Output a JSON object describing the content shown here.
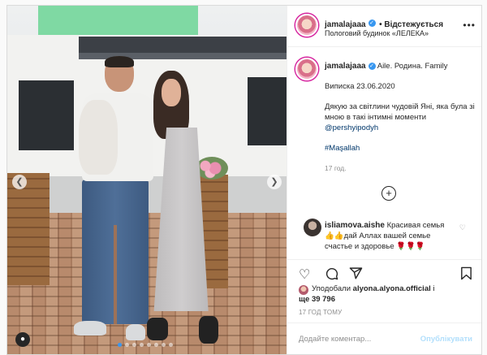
{
  "header": {
    "username": "jamalajaaa",
    "follow_status": "• Відстежується",
    "location": "Пологовий будинок «ЛЕЛЕКА»",
    "more_icon": "more-horizontal-icon"
  },
  "caption": {
    "username": "jamalajaaa",
    "line1": "Aile. Родина. Family",
    "line2": "Виписка 23.06.2020",
    "line3": "Дякую за світлини чудовій Яні, яка була зі мною в такі інтимні моменти",
    "mention": "@pershyipodyh",
    "hashtag": "#Maşallah",
    "time": "17 год."
  },
  "comment": {
    "username": "isliamova.aishe",
    "text1": "Красивая семья",
    "text2": "👍👍дай Аллах вашей семье",
    "text3": "счастье и здоровье 🌹🌹🌹"
  },
  "likes": {
    "prefix": "Уподобали",
    "user": "alyona.alyona.official",
    "suffix": "і",
    "count_line": "ще 39 796"
  },
  "posted_ago": "17 ГОД ТОМУ",
  "add_comment": {
    "placeholder": "Додайте коментар...",
    "publish": "Опублікувати"
  },
  "carousel": {
    "dot_count": 8,
    "active_index": 0
  },
  "colors": {
    "verified": "#3897f0",
    "link": "#00376b",
    "publish_disabled": "#b2dffc"
  }
}
